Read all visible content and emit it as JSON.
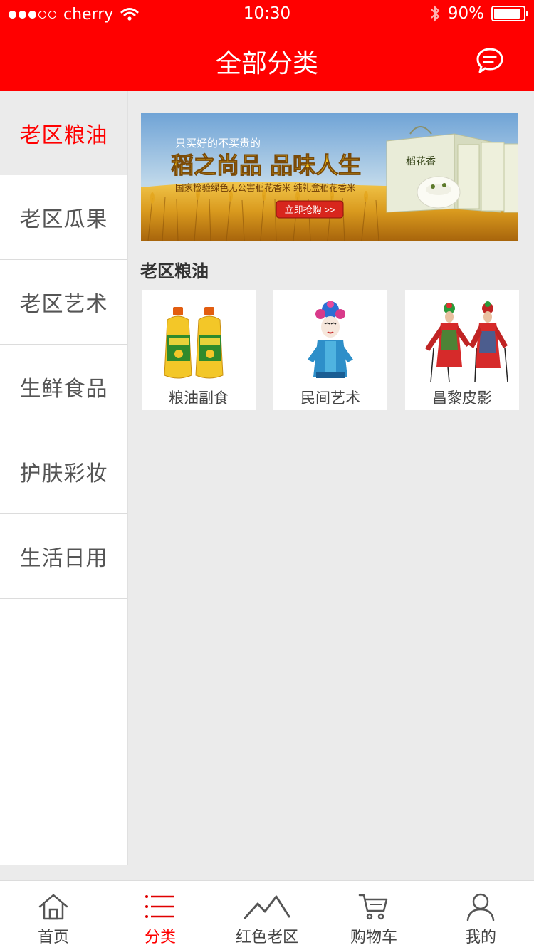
{
  "status_bar": {
    "carrier": "cherry",
    "time": "10:30",
    "battery": "90%",
    "battery_level": 0.9,
    "signal_dots": [
      true,
      true,
      true,
      false,
      false
    ]
  },
  "header": {
    "title": "全部分类",
    "message_icon": "chat-bubble-icon"
  },
  "sidebar": {
    "items": [
      {
        "label": "老区粮油",
        "active": true
      },
      {
        "label": "老区瓜果",
        "active": false
      },
      {
        "label": "老区艺术",
        "active": false
      },
      {
        "label": "生鲜食品",
        "active": false
      },
      {
        "label": "护肤彩妆",
        "active": false
      },
      {
        "label": "生活日用",
        "active": false
      }
    ]
  },
  "banner": {
    "small_text": "只买好的不买贵的",
    "headline": "稻之尚品 品味人生",
    "subline": "国家检验绿色无公害稻花香米    纯礼盒稻花香米",
    "button": "立即抢购 >>",
    "box_text": "稻花香"
  },
  "section": {
    "title": "老区粮油",
    "items": [
      {
        "label": "粮油副食",
        "icon": "cooking-oil-bottles-image"
      },
      {
        "label": "民间艺术",
        "icon": "opera-doll-image"
      },
      {
        "label": "昌黎皮影",
        "icon": "shadow-puppets-image"
      }
    ]
  },
  "tab_bar": {
    "tabs": [
      {
        "label": "首页",
        "icon": "home-icon",
        "active": false
      },
      {
        "label": "分类",
        "icon": "list-icon",
        "active": true
      },
      {
        "label": "红色老区",
        "icon": "mountain-icon",
        "active": false
      },
      {
        "label": "购物车",
        "icon": "cart-icon",
        "active": false
      },
      {
        "label": "我的",
        "icon": "user-icon",
        "active": false
      }
    ]
  },
  "colors": {
    "brand_red": "#ff0000",
    "background": "#ebebeb"
  }
}
